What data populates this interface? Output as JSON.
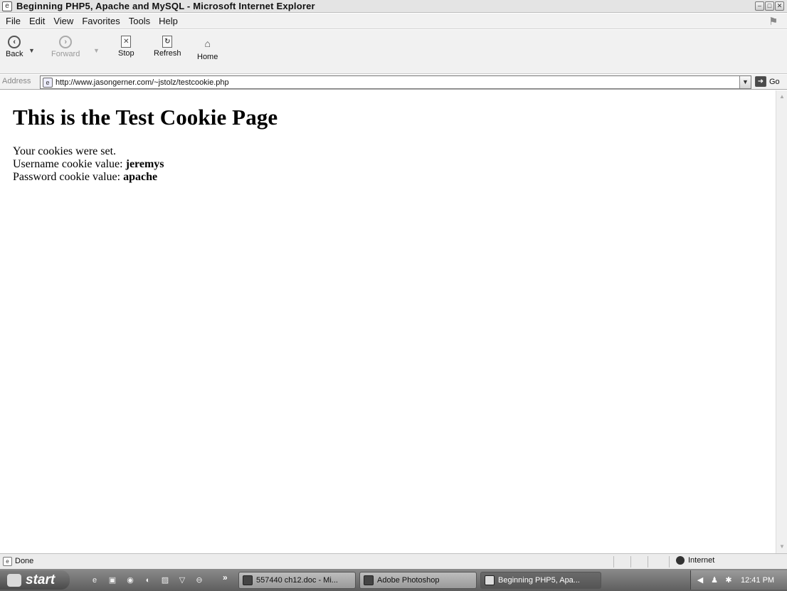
{
  "window": {
    "title": "Beginning PHP5, Apache and MySQL - Microsoft Internet Explorer"
  },
  "menu": [
    "File",
    "Edit",
    "View",
    "Favorites",
    "Tools",
    "Help"
  ],
  "toolbar": {
    "back": "Back",
    "forward": "Forward",
    "stop": "Stop",
    "refresh": "Refresh",
    "home": "Home"
  },
  "address": {
    "label": "Address",
    "url": "http://www.jasongerner.com/~jstolz/testcookie.php",
    "go": "Go"
  },
  "page": {
    "heading": "This is the Test Cookie Page",
    "line1": "Your cookies were set.",
    "username_label": "Username cookie value:",
    "username_value": "jeremys",
    "password_label": "Password cookie value:",
    "password_value": "apache"
  },
  "status": {
    "text": "Done",
    "zone": "Internet"
  },
  "taskbar": {
    "start": "start",
    "tasks": [
      "557440 ch12.doc - Mi...",
      "Adobe Photoshop",
      "Beginning PHP5, Apa..."
    ],
    "time": "12:41 PM"
  }
}
